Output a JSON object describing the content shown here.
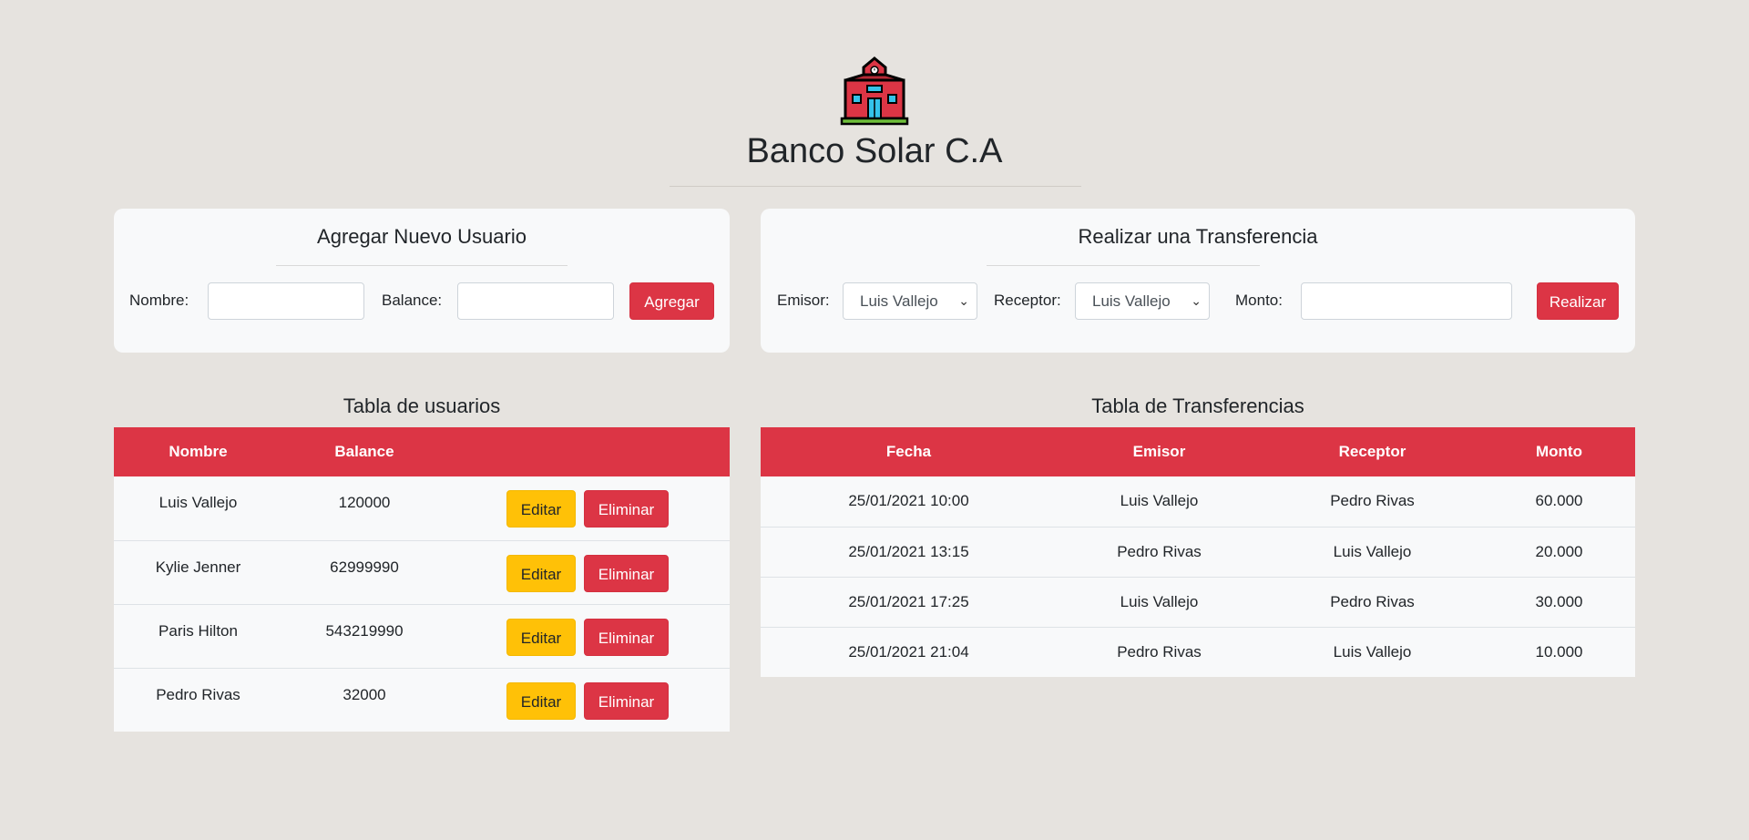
{
  "header": {
    "logo_icon": "school-building-icon",
    "title": "Banco Solar C.A"
  },
  "add_user_form": {
    "title": "Agregar Nuevo Usuario",
    "name_label": "Nombre:",
    "name_value": "",
    "balance_label": "Balance:",
    "balance_value": "",
    "submit_label": "Agregar"
  },
  "transfer_form": {
    "title": "Realizar una Transferencia",
    "sender_label": "Emisor:",
    "sender_selected": "Luis Vallejo",
    "receiver_label": "Receptor:",
    "receiver_selected": "Luis Vallejo",
    "amount_label": "Monto:",
    "amount_value": "",
    "submit_label": "Realizar"
  },
  "users_table": {
    "title": "Tabla de usuarios",
    "columns": [
      "Nombre",
      "Balance",
      ""
    ],
    "edit_label": "Editar",
    "delete_label": "Eliminar",
    "rows": [
      {
        "name": "Luis Vallejo",
        "balance": "120000"
      },
      {
        "name": "Kylie Jenner",
        "balance": "62999990"
      },
      {
        "name": "Paris Hilton",
        "balance": "543219990"
      },
      {
        "name": "Pedro Rivas",
        "balance": "32000"
      }
    ]
  },
  "transfers_table": {
    "title": "Tabla de Transferencias",
    "columns": [
      "Fecha",
      "Emisor",
      "Receptor",
      "Monto"
    ],
    "rows": [
      {
        "date": "25/01/2021 10:00",
        "sender": "Luis Vallejo",
        "receiver": "Pedro Rivas",
        "amount": "60.000"
      },
      {
        "date": "25/01/2021 13:15",
        "sender": "Pedro Rivas",
        "receiver": "Luis Vallejo",
        "amount": "20.000"
      },
      {
        "date": "25/01/2021 17:25",
        "sender": "Luis Vallejo",
        "receiver": "Pedro Rivas",
        "amount": "30.000"
      },
      {
        "date": "25/01/2021 21:04",
        "sender": "Pedro Rivas",
        "receiver": "Luis Vallejo",
        "amount": "10.000"
      }
    ]
  },
  "colors": {
    "background": "#e6e3df",
    "accent_red": "#dc3545",
    "edit_yellow": "#ffc107",
    "card_bg": "#f8f9fa"
  }
}
